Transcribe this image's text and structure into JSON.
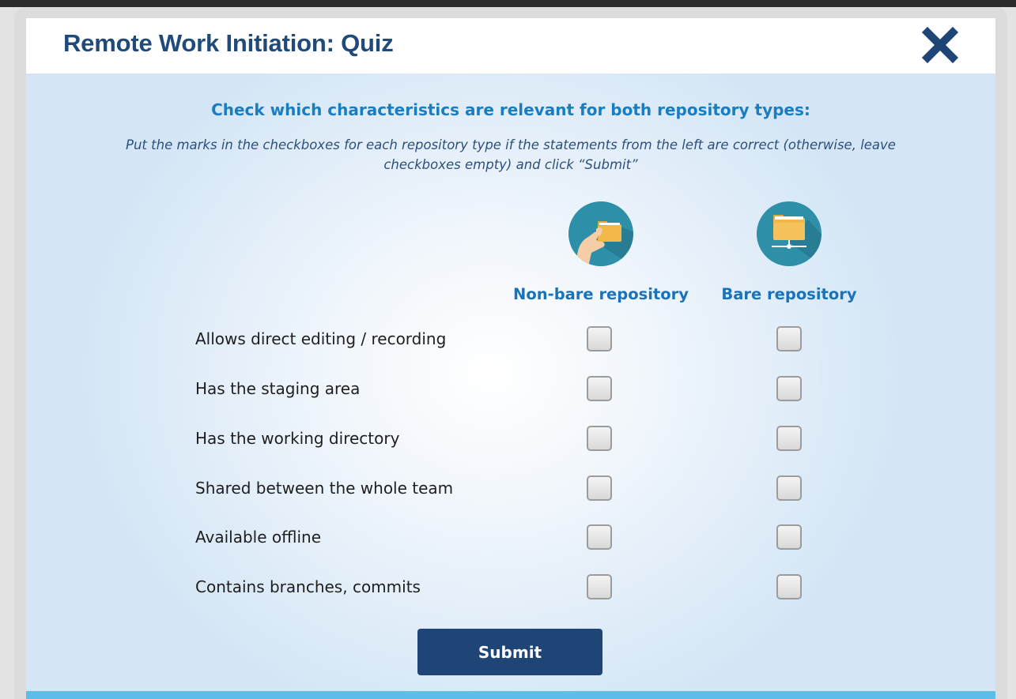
{
  "dialog": {
    "title": "Remote Work Initiation: Quiz",
    "close_icon": "close-x-icon"
  },
  "quiz": {
    "question": "Check which characteristics are relevant for both repository types:",
    "instruction": "Put the marks in the checkboxes for each repository type if the statements from the left are correct (otherwise, leave checkboxes empty) and click “Submit”",
    "columns": [
      {
        "label": "Non-bare repository",
        "icon": "hand-holding-folder-icon"
      },
      {
        "label": "Bare repository",
        "icon": "shared-folder-icon"
      }
    ],
    "rows": [
      {
        "label": "Allows direct editing / recording",
        "non_bare_checked": false,
        "bare_checked": false
      },
      {
        "label": "Has the staging area",
        "non_bare_checked": false,
        "bare_checked": false
      },
      {
        "label": "Has the working directory",
        "non_bare_checked": false,
        "bare_checked": false
      },
      {
        "label": "Shared between the whole team",
        "non_bare_checked": false,
        "bare_checked": false
      },
      {
        "label": "Available offline",
        "non_bare_checked": false,
        "bare_checked": false
      },
      {
        "label": "Contains branches, commits",
        "non_bare_checked": false,
        "bare_checked": false
      }
    ],
    "submit_label": "Submit"
  },
  "colors": {
    "title": "#1f4a7a",
    "question": "#1a7dc0",
    "submit_bg": "#1f4576",
    "icon_circle": "#2e8fa8",
    "folder": "#f2b94a",
    "bottom_bar": "#5dbde9"
  }
}
